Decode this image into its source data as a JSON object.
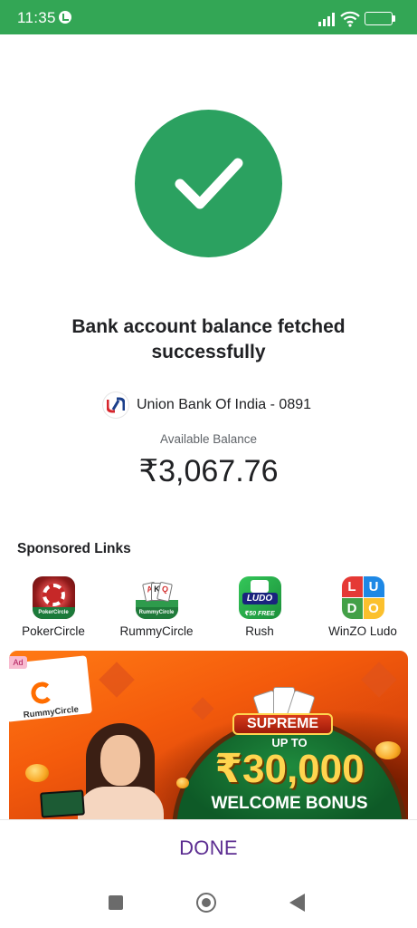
{
  "status_bar": {
    "time": "11:35",
    "battery": "83",
    "battery_level": 0.83,
    "background_color": "#33a655"
  },
  "result": {
    "icon": "check-icon",
    "icon_color": "#2ba160",
    "title": "Bank account balance fetched successfully"
  },
  "account": {
    "bank_logo": "union-bank-logo",
    "bank_name": "Union Bank Of India - 0891",
    "balance_label": "Available Balance",
    "balance": "₹3,067.76"
  },
  "sponsored": {
    "title": "Sponsored Links",
    "apps": [
      {
        "name": "PokerCircle",
        "icon": "pokercircle-icon"
      },
      {
        "name": "RummyCircle",
        "icon": "rummycircle-icon"
      },
      {
        "name": "Rush",
        "icon": "rush-icon"
      },
      {
        "name": "WinZO Ludo",
        "icon": "winzo-ludo-icon"
      }
    ]
  },
  "ad": {
    "badge": "Ad",
    "brand": "RummyCircle",
    "headline": "SUPREME",
    "upto": "UP TO",
    "amount": "₹30,000",
    "offer": "WELCOME BONUS"
  },
  "footer": {
    "done_label": "DONE",
    "accent_color": "#5c2d91"
  }
}
